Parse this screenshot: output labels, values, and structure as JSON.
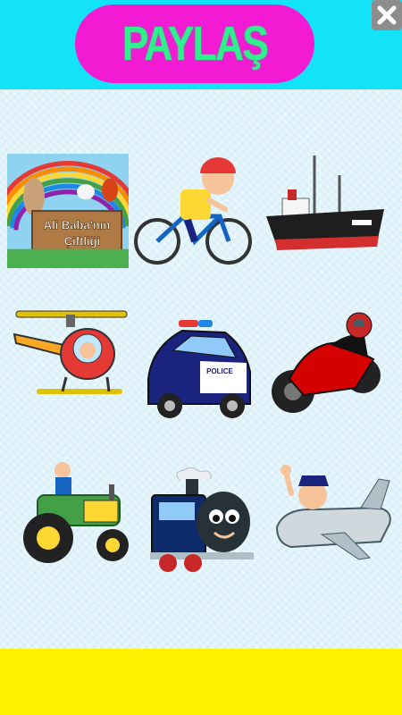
{
  "header": {
    "share_label": "PAYLAŞ",
    "close_icon": "close-icon"
  },
  "colors": {
    "header_bg": "#12e3f6",
    "share_pill": "#f21bd3",
    "share_text": "#2ff08c",
    "footer_bg": "#fff100",
    "close_bg": "#8d8d8d"
  },
  "grid": {
    "items": [
      {
        "icon": "farm-sign-icon",
        "line1": "Ali Baba'nın",
        "line2": "Çiftliği"
      },
      {
        "icon": "bicycle-icon"
      },
      {
        "icon": "ship-icon"
      },
      {
        "icon": "helicopter-icon"
      },
      {
        "icon": "police-car-icon",
        "car_text": "POLICE"
      },
      {
        "icon": "motorcycle-icon"
      },
      {
        "icon": "tractor-icon"
      },
      {
        "icon": "train-icon"
      },
      {
        "icon": "airplane-icon"
      }
    ]
  }
}
